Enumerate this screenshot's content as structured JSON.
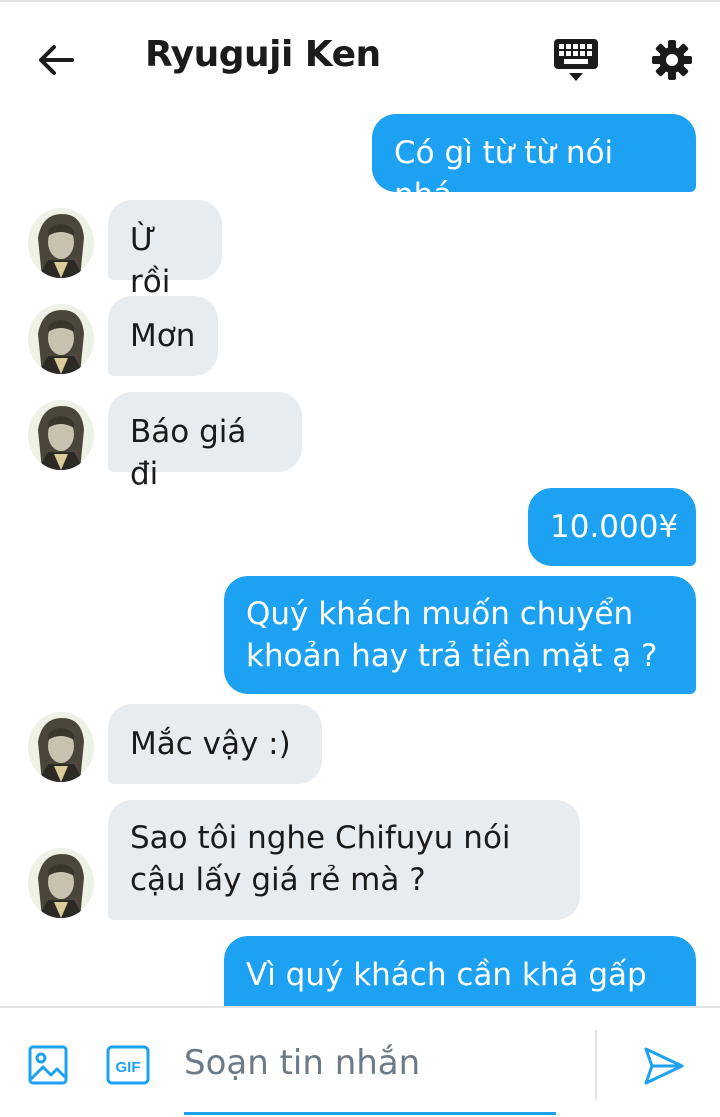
{
  "header": {
    "title": "Ryuguji Ken"
  },
  "messages": [
    {
      "side": "out",
      "text": "Có gì từ từ nói nhá"
    },
    {
      "side": "in",
      "text": "Ừ rồi"
    },
    {
      "side": "in",
      "text": "Mơn"
    },
    {
      "side": "in",
      "text": "Báo giá đi"
    },
    {
      "side": "out",
      "text": "10.000¥"
    },
    {
      "side": "out",
      "text": "Quý khách muốn chuyển\nkhoản hay trả tiền mặt ạ ?"
    },
    {
      "side": "in",
      "text": "Mắc vậy :)"
    },
    {
      "side": "in",
      "text": "Sao tôi nghe Chifuyu nói\ncậu lấy giá rẻ mà ?"
    },
    {
      "side": "out",
      "text": "Vì quý khách cần khá gấp"
    }
  ],
  "composer": {
    "placeholder": "Soạn tin nhắn",
    "gif_label": "GIF"
  },
  "colors": {
    "accent": "#1da1f2",
    "incoming_bubble": "#e6ecf0"
  },
  "icons": [
    "back-arrow-icon",
    "keyboard-icon",
    "settings-gear-icon",
    "image-icon",
    "gif-icon",
    "send-icon"
  ]
}
